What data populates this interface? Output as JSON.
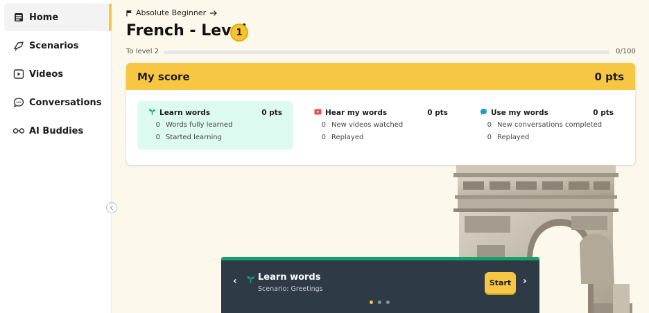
{
  "sidebar": {
    "items": [
      {
        "label": "Home",
        "icon": "home-icon",
        "active": true
      },
      {
        "label": "Scenarios",
        "icon": "scenarios-icon"
      },
      {
        "label": "Videos",
        "icon": "video-icon"
      },
      {
        "label": "Conversations",
        "icon": "chat-icon"
      },
      {
        "label": "AI Buddies",
        "icon": "glasses-icon"
      }
    ]
  },
  "header": {
    "breadcrumb": "Absolute Beginner",
    "title": "French - Level",
    "level": "1",
    "progress_label": "To level 2",
    "progress_count": "0/100",
    "progress_fraction": 0
  },
  "score": {
    "title": "My score",
    "total": "0 pts",
    "columns": [
      {
        "title": "Learn words",
        "pts": "0 pts",
        "icon": "sprout-icon",
        "rows": [
          {
            "num": "0",
            "text": "Words fully learned"
          },
          {
            "num": "0",
            "text": "Started learning"
          }
        ]
      },
      {
        "title": "Hear my words",
        "pts": "0 pts",
        "icon": "play-video-icon",
        "rows": [
          {
            "num": "0",
            "text": "New videos watched"
          },
          {
            "num": "0",
            "text": "Replayed"
          }
        ]
      },
      {
        "title": "Use my words",
        "pts": "0 pts",
        "icon": "speech-bubble-icon",
        "rows": [
          {
            "num": "0",
            "text": "New conversations completed"
          },
          {
            "num": "0",
            "text": "Replayed"
          }
        ]
      }
    ]
  },
  "banner": {
    "title": "Learn words",
    "subtitle": "Scenario: Greetings",
    "start_label": "Start",
    "prev_label": "‹",
    "next_label": "›"
  },
  "colors": {
    "accent": "#f7c744",
    "banner_bg": "#2f3a47",
    "banner_accent": "#12a36d",
    "learn_highlight": "#dcfaf0"
  }
}
